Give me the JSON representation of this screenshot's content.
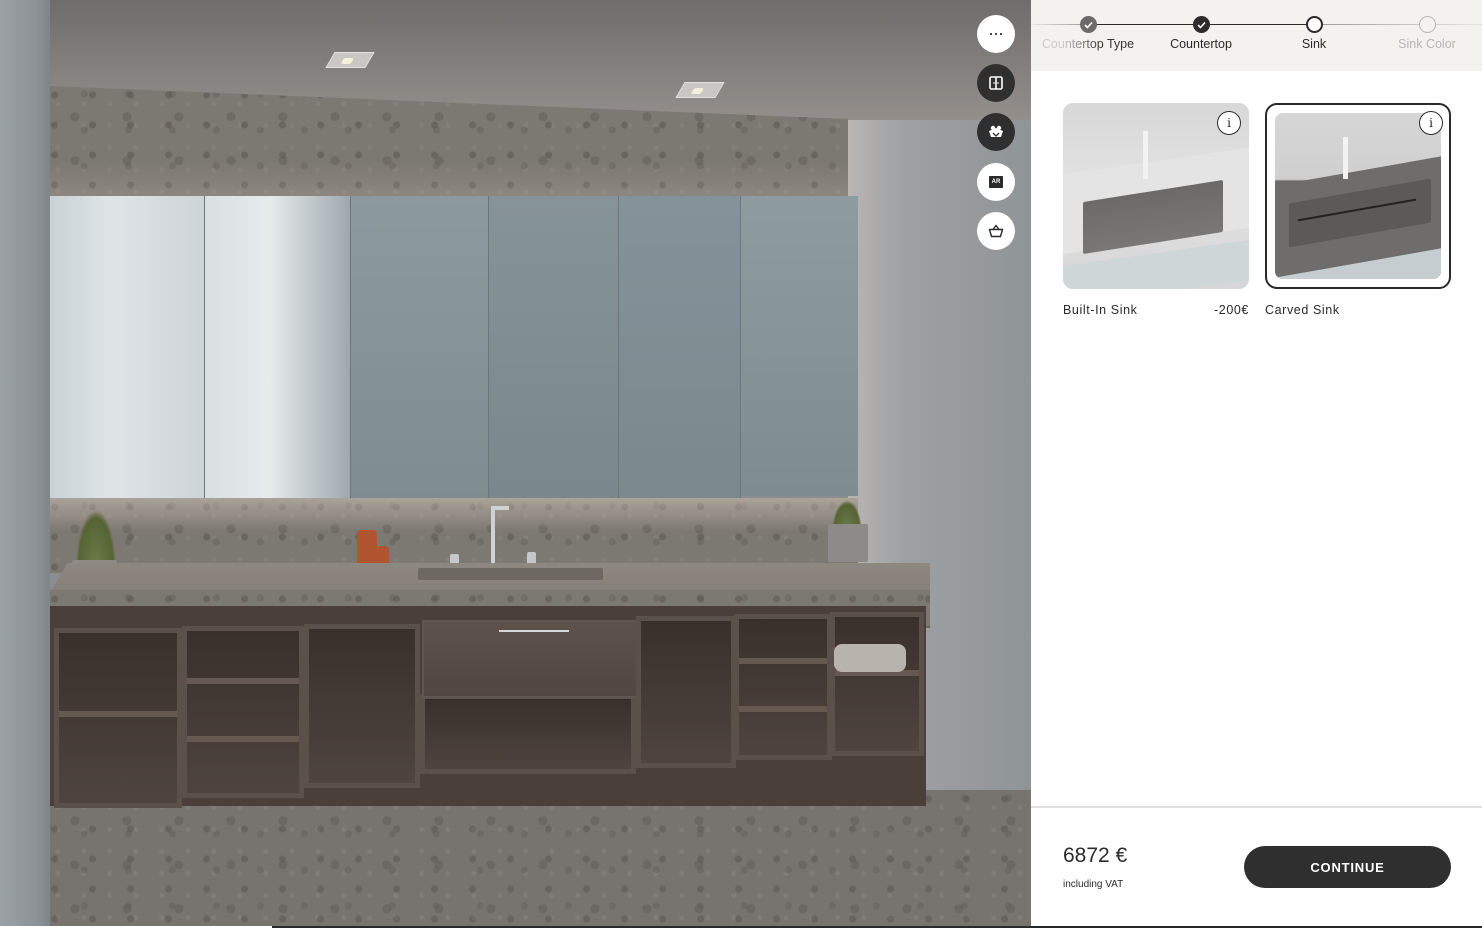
{
  "scene": {
    "description": "3D bathroom vanity configurator preview",
    "toolbar": [
      {
        "id": "more",
        "icon": "more-horizontal-icon",
        "label": "More options",
        "style": "light"
      },
      {
        "id": "cabinet",
        "icon": "cabinet-doors-icon",
        "label": "Cabinet view",
        "style": "dark"
      },
      {
        "id": "decor",
        "icon": "decor-accessories-icon",
        "label": "Accessories",
        "style": "dark"
      },
      {
        "id": "ar",
        "icon": "ar-icon",
        "label": "AR",
        "style": "light"
      },
      {
        "id": "basket",
        "icon": "basket-icon",
        "label": "Basket",
        "style": "light"
      }
    ],
    "ar_label": "AR"
  },
  "stepper": {
    "steps": [
      {
        "label": "Countertop Type",
        "state": "completed"
      },
      {
        "label": "Countertop",
        "state": "completed"
      },
      {
        "label": "Sink",
        "state": "current"
      },
      {
        "label": "Sink Color",
        "state": "upcoming"
      }
    ]
  },
  "options": [
    {
      "name": "Built-In Sink",
      "price": "-200€",
      "selected": false,
      "info_label": "i"
    },
    {
      "name": "Carved Sink",
      "price": "",
      "selected": true,
      "info_label": "i"
    }
  ],
  "footer": {
    "price": "6872 €",
    "vat_note": "including VAT",
    "continue_label": "CONTINUE"
  },
  "colors": {
    "accent_dark": "#2f2f2f",
    "stepper_bg": "#f3f2ef",
    "completed_step_grey": "#6b6b6b",
    "upcoming_step": "#b9b9b9"
  }
}
